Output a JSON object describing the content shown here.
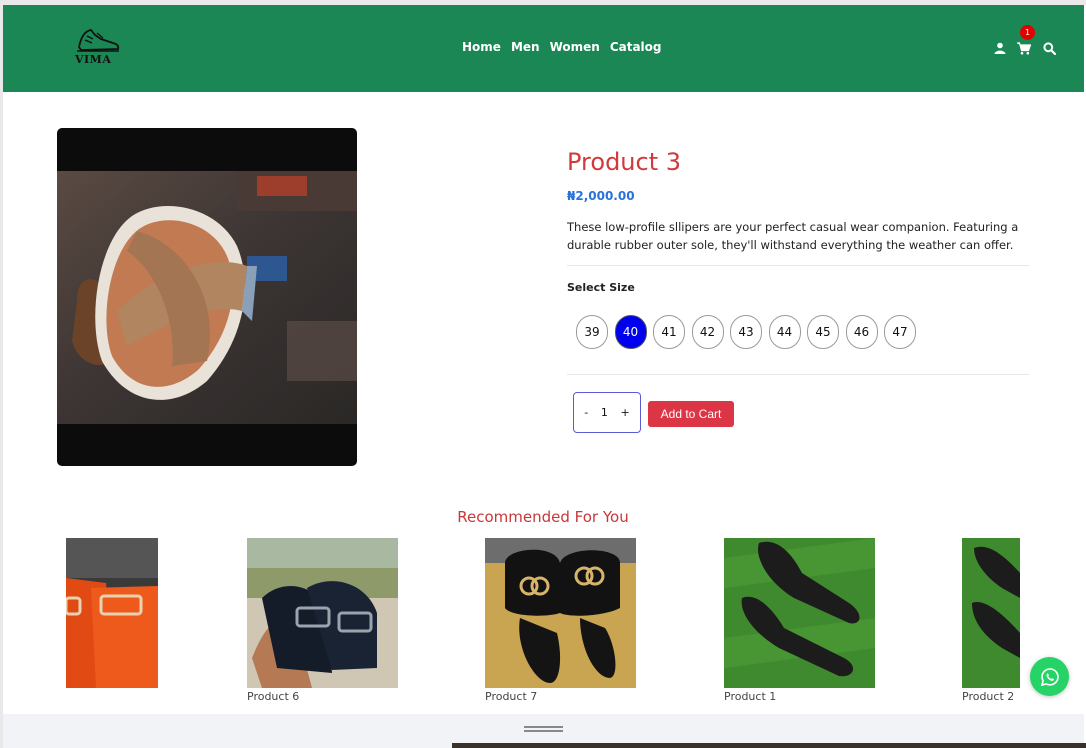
{
  "brand": {
    "logo_text": "VIMA"
  },
  "nav": {
    "items": [
      "Home",
      "Men",
      "Women",
      "Catalog"
    ]
  },
  "header": {
    "cart_count": "1",
    "icons": [
      "user-icon",
      "cart-icon",
      "search-icon"
    ]
  },
  "product": {
    "title": "Product 3",
    "price": "₦2,000.00",
    "description": "These low-profile sllipers are your perfect casual wear companion. Featuring a durable rubber outer sole, they'll withstand everything the weather can offer.",
    "size_label": "Select Size",
    "sizes": [
      "39",
      "40",
      "41",
      "42",
      "43",
      "44",
      "45",
      "46",
      "47"
    ],
    "selected_size": "40",
    "quantity": "1",
    "qty_minus": "-",
    "qty_plus": "+",
    "add_to_cart": "Add to Cart"
  },
  "recommended": {
    "title": "Recommended For You",
    "items": [
      {
        "name": ""
      },
      {
        "name": "Product 6"
      },
      {
        "name": "Product 7"
      },
      {
        "name": "Product 1"
      },
      {
        "name": "Product 2"
      }
    ]
  },
  "colors": {
    "header": "#1b8754",
    "title_red": "#d13a3a",
    "price_blue": "#2a72d8",
    "selected_size": "#0000ee",
    "add_cart": "#dc3545",
    "whatsapp": "#25d366"
  }
}
